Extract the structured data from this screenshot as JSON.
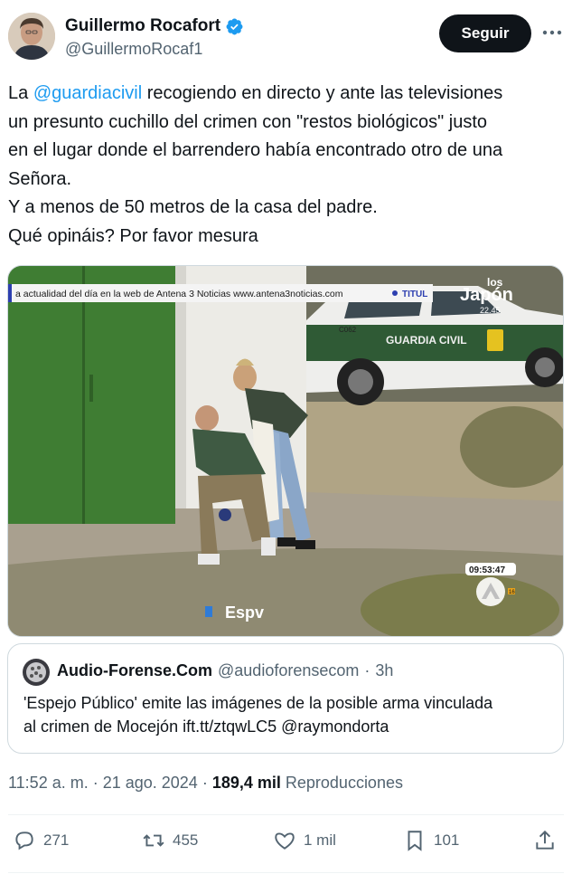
{
  "author": {
    "name": "Guillermo Rocafort",
    "handle": "@GuillermoRocaf1"
  },
  "follow_label": "Seguir",
  "tweet": {
    "lines": [
      {
        "mention": "@guardiacivil",
        "before": "La ",
        "after": " recogiendo en directo y ante las televisiones"
      },
      "un presunto cuchillo del crimen con \"restos biológicos\" justo",
      "en el lugar donde el barrendero había encontrado otro de una",
      "Señora.",
      "Y a menos de 50 metros de la casa del padre.",
      "Qué opináis? Por favor mesura"
    ]
  },
  "media": {
    "ticker": "a actualidad del día en la web de Antena 3 Noticias www.antena3noticias.com",
    "ticker_tag": "TITUL",
    "channel_logo_small": "los",
    "channel_logo": "Japón",
    "channel_time": "22.45",
    "vehicle_text": "GUARDIA CIVIL",
    "vehicle_plate": "C062",
    "clock": "09:53:47",
    "program_logo": "Espv",
    "age_rating": "16"
  },
  "quote": {
    "name": "Audio-Forense.Com",
    "handle": "@audioforensecom",
    "dot": "·",
    "time": "3h",
    "lines": [
      "'Espejo Público' emite las imágenes de la posible arma vinculada",
      "al crimen de Mocejón ift.tt/ztqwLC5 @raymondorta"
    ]
  },
  "meta": {
    "time": "11:52 a. m.",
    "sep1": "·",
    "date": "21 ago. 2024",
    "sep2": "·",
    "views": "189,4 mil",
    "views_label": "Reproducciones"
  },
  "actions": {
    "replies": "271",
    "reposts": "455",
    "likes": "1 mil",
    "bookmarks": "101"
  },
  "colors": {
    "accent": "#1d9bf0",
    "text": "#0f1419",
    "secondary": "#536471",
    "border": "#cfd9de"
  },
  "icons": [
    "verified-badge-icon",
    "more-options-icon",
    "reply-icon",
    "repost-icon",
    "like-icon",
    "bookmark-icon",
    "share-icon"
  ]
}
